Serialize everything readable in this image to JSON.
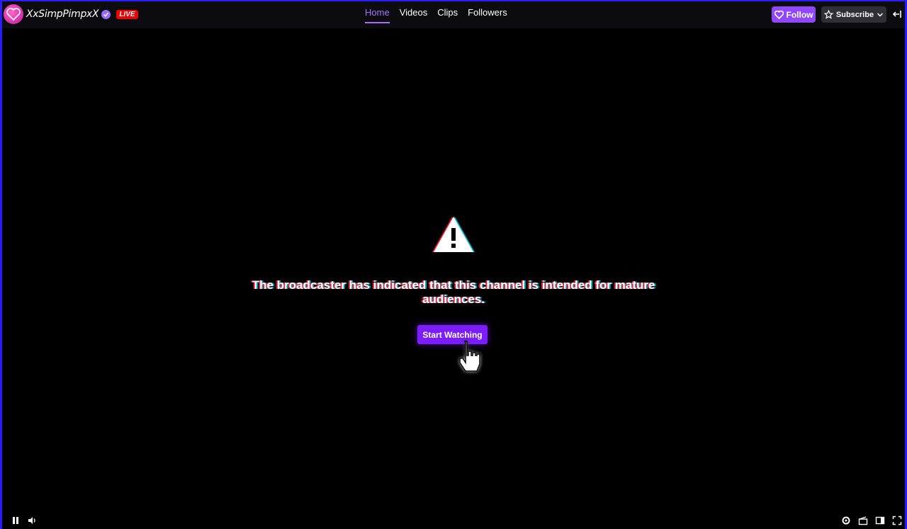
{
  "header": {
    "channel_name": "XxSimpPimpxX",
    "live_label": "LIVE",
    "tabs": [
      {
        "label": "Home",
        "active": true
      },
      {
        "label": "Videos",
        "active": false
      },
      {
        "label": "Clips",
        "active": false
      },
      {
        "label": "Followers",
        "active": false
      }
    ],
    "follow_label": "Follow",
    "subscribe_label": "Subscribe"
  },
  "overlay": {
    "message": "The broadcaster has indicated that this channel is intended for mature audiences.",
    "start_button_label": "Start Watching",
    "icon": "warning-triangle-icon"
  },
  "player_controls": {
    "left": [
      "pause-icon",
      "volume-icon"
    ],
    "right": [
      "settings-icon",
      "clip-icon",
      "theatre-mode-icon",
      "fullscreen-icon"
    ]
  },
  "colors": {
    "accent": "#9147ff",
    "live": "#eb0400",
    "frame_border": "#2a1cff",
    "background": "#000000"
  }
}
